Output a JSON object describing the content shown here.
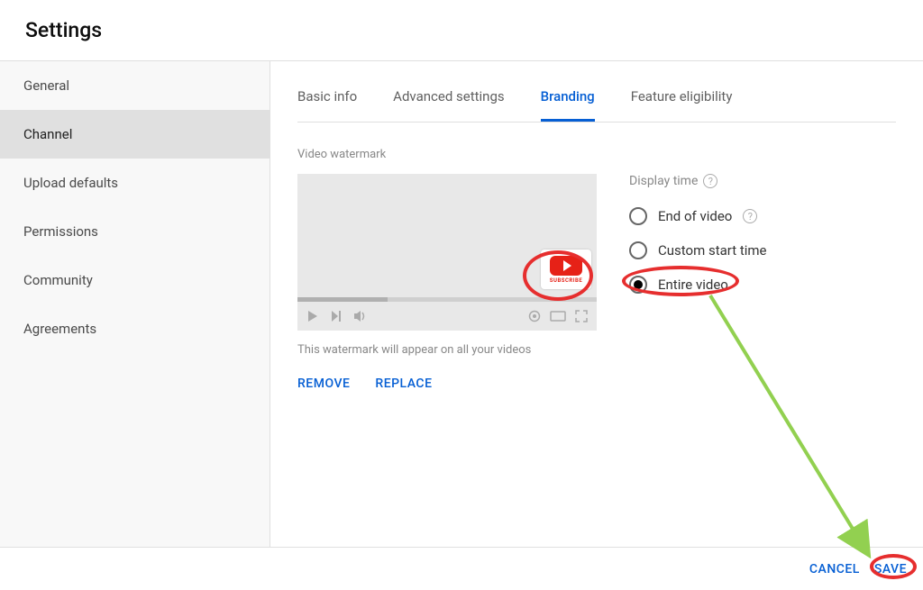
{
  "header": {
    "title": "Settings"
  },
  "sidebar": {
    "items": [
      {
        "label": "General"
      },
      {
        "label": "Channel"
      },
      {
        "label": "Upload defaults"
      },
      {
        "label": "Permissions"
      },
      {
        "label": "Community"
      },
      {
        "label": "Agreements"
      }
    ],
    "active_index": 1
  },
  "tabs": {
    "items": [
      {
        "label": "Basic info"
      },
      {
        "label": "Advanced settings"
      },
      {
        "label": "Branding"
      },
      {
        "label": "Feature eligibility"
      }
    ],
    "active_index": 2
  },
  "watermark": {
    "section_label": "Video watermark",
    "badge_text": "SUBSCRIBE",
    "caption": "This watermark will appear on all your videos",
    "remove_label": "REMOVE",
    "replace_label": "REPLACE"
  },
  "display_time": {
    "title": "Display time",
    "options": [
      {
        "label": "End of video",
        "has_help": true
      },
      {
        "label": "Custom start time",
        "has_help": false
      },
      {
        "label": "Entire video",
        "has_help": false
      }
    ],
    "selected_index": 2
  },
  "footer": {
    "cancel_label": "CANCEL",
    "save_label": "SAVE"
  },
  "colors": {
    "accent": "#065fd4",
    "annotation_red": "#e62e2e",
    "arrow_green": "#92d050"
  }
}
